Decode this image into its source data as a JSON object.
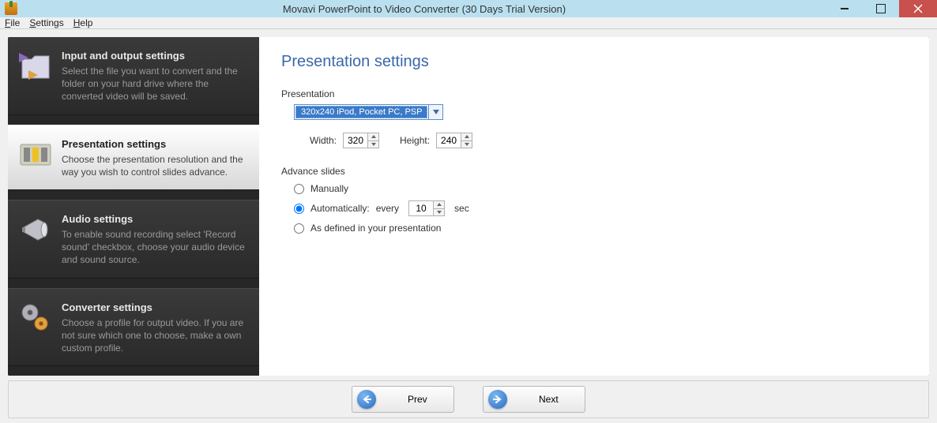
{
  "window": {
    "title": "Movavi PowerPoint to Video Converter (30 Days Trial Version)"
  },
  "menu": {
    "file": "File",
    "settings": "Settings",
    "help": "Help"
  },
  "sidebar": {
    "items": [
      {
        "title": "Input and output settings",
        "desc": "Select the file you want to convert and the folder on your hard drive where the converted video will be saved."
      },
      {
        "title": "Presentation settings",
        "desc": "Choose the presentation resolution and the way you wish to control slides advance."
      },
      {
        "title": "Audio settings",
        "desc": "To enable sound recording select 'Record sound' checkbox, choose your audio device and sound source."
      },
      {
        "title": "Converter settings",
        "desc": "Choose a profile for output video. If you are not sure which one to choose, make a own custom profile."
      }
    ]
  },
  "content": {
    "heading": "Presentation settings",
    "presentation_label": "Presentation",
    "preset_selected": "320x240 iPod, Pocket PC, PSP",
    "width_label": "Width:",
    "width_value": "320",
    "height_label": "Height:",
    "height_value": "240",
    "advance_label": "Advance slides",
    "advance": {
      "manually": "Manually",
      "automatically_prefix": "Automatically:",
      "automatically_every": "every",
      "automatically_seconds": "10",
      "automatically_suffix": "sec",
      "as_defined": "As defined in your presentation",
      "selected": "automatically"
    }
  },
  "footer": {
    "prev": "Prev",
    "next": "Next"
  }
}
